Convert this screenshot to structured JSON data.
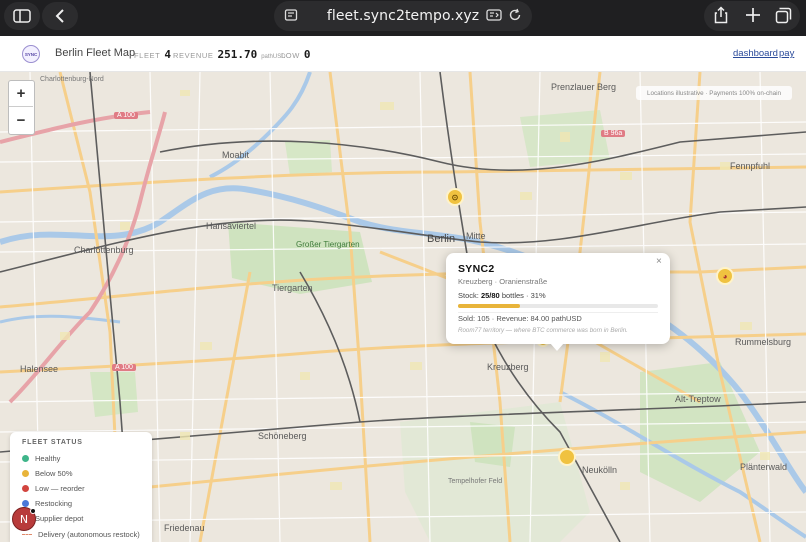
{
  "browser": {
    "url": "fleet.sync2tempo.xyz",
    "icons": {
      "sidebar": "sidebar-icon",
      "back": "chevron-left-icon",
      "tabs_view": "tab-overview-icon",
      "reader": "reader-icon",
      "reload": "reload-icon",
      "share": "share-icon",
      "new_tab": "plus-icon",
      "tab_switcher": "tabs-icon"
    }
  },
  "header": {
    "logo_text": "SYNC",
    "title": "Berlin Fleet Map",
    "fleet_label": "FLEET",
    "fleet_value": "4",
    "revenue_label": "REVENUE",
    "revenue_value": "251.70",
    "revenue_unit": "pathUSD",
    "low_label": "LOW",
    "low_value": "0",
    "dashboard_link": "dashboard",
    "pay_link": "pay"
  },
  "map": {
    "attribution": "Locations illustrative · Payments 100% on-chain",
    "zoom_in": "+",
    "zoom_out": "−",
    "labels": {
      "berlin": "Berlin",
      "mitte": "Mitte",
      "moabit": "Moabit",
      "hansaviertel": "Hansaviertel",
      "charlottenburg": "Charlottenburg",
      "tiergarten": "Tiergarten",
      "grosser_tiergarten": "Großer Tiergarten",
      "kreuzberg": "Kreuzberg",
      "neukolln": "Neukölln",
      "schoneberg": "Schöneberg",
      "friedenau": "Friedenau",
      "halensee": "Halensee",
      "prenzlauer_berg": "Prenzlauer Berg",
      "fennpfuhl": "Fennpfuhl",
      "alt_treptow": "Alt-Treptow",
      "rummelsburg": "Rummelsburg",
      "plänterwald": "Plänterwald",
      "tempelhofer_feld": "Tempelhofer Feld",
      "charlottenburg_nord": "Charlottenburg-Nord",
      "a100": "A 100",
      "b96a": "B 96a"
    },
    "colors": {
      "land": "#ece7de",
      "park": "#cfe3bf",
      "water": "#aac9e8",
      "major_road": "#f6cf8a",
      "rail": "#5a5a5a"
    }
  },
  "popup": {
    "name": "SYNC2",
    "location": "Kreuzberg · Oranienstraße",
    "stock_label": "Stock:",
    "stock_value": "25/80",
    "stock_unit": "bottles",
    "stock_percent": "31%",
    "stock_fraction": 0.31,
    "sold": "Sold: 105 · Revenue: 84.00 pathUSD",
    "note": "Room77 territory — where BTC commerce was born in Berlin.",
    "close": "×"
  },
  "legend": {
    "title": "FLEET STATUS",
    "items": [
      {
        "label": "Healthy",
        "color": "#3fb58a"
      },
      {
        "label": "Below 50%",
        "color": "#e8b43a"
      },
      {
        "label": "Low — reorder",
        "color": "#d2453f"
      },
      {
        "label": "Restocking",
        "color": "#4a78d8"
      },
      {
        "label": "Supplier depot",
        "color": "#e08a6a"
      },
      {
        "label": "Delivery (autonomous restock)",
        "color": "#e08a6a"
      }
    ]
  },
  "avatar": {
    "letter": "N"
  }
}
